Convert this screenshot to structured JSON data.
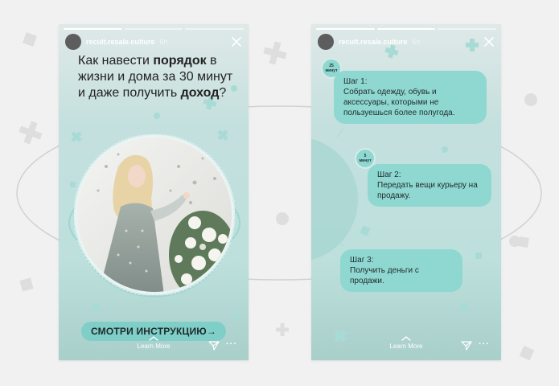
{
  "story_left": {
    "username": "recult.resale.culture",
    "time": "6h",
    "headline": {
      "part1": "Как навести ",
      "bold1": "порядок",
      "part2": " в жизни и дома за 30 минут и даже получить ",
      "bold2": "доход",
      "part3": "?"
    },
    "cta_label": "СМОТРИ ИНСТРУКЦИЮ",
    "cta_arrow": "→",
    "learn_more": "Learn More",
    "more": "···"
  },
  "story_right": {
    "username": "recult.resale.culture",
    "time": "6h",
    "steps": [
      {
        "title": "Шаг 1:",
        "text": "Собрать одежду, обувь и аксессуары, которыми не пользуешься более полугода.",
        "badge_num": "25",
        "badge_unit": "минут"
      },
      {
        "title": "Шаг 2:",
        "text": "Передать вещи курьеру на продажу.",
        "badge_num": "5",
        "badge_unit": "минут"
      },
      {
        "title": "Шаг 3:",
        "text": "Получить деньги с продажи."
      }
    ],
    "learn_more": "Learn More",
    "more": "···"
  },
  "colors": {
    "accent": "#8fd8d2",
    "cta": "#7fcfc8",
    "background": "#f1f1f1",
    "story_bg": "#c4e0de"
  },
  "icons": [
    "close-icon",
    "chevron-up-icon",
    "send-icon",
    "more-icon",
    "plus-shape",
    "dot-shape"
  ]
}
